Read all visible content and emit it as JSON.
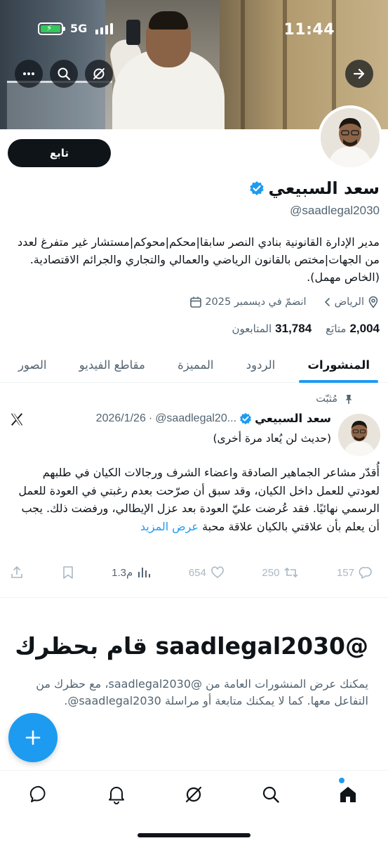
{
  "status_bar": {
    "time": "11:44",
    "network": "5G"
  },
  "profile": {
    "display_name": "سعد السبيعي",
    "handle": "@saadlegal2030",
    "follow_label": "تابع",
    "bio": "مدير الإدارة القانونية بنادي النصر سابقا|محكم|محوكم|مستشار غير متفرغ لعدد من الجهات|مختص بالقانون الرياضي والعمالي والتجاري والجرائم الاقتصادية. (الخاص مهمل).",
    "location": "الرياض",
    "joined": "انضمّ في ديسمبر 2025",
    "following_count": "2,004",
    "following_label": "متابَع",
    "followers_count": "31,784",
    "followers_label": "المتابعون"
  },
  "tabs": [
    {
      "label": "المنشورات"
    },
    {
      "label": "الردود"
    },
    {
      "label": "المميزة"
    },
    {
      "label": "مقاطع الفيديو"
    },
    {
      "label": "الصور"
    }
  ],
  "pinned_post": {
    "pinned_label": "مُثبّت",
    "author_name": "سعد السبيعي",
    "author_handle": "@saadlegal20...",
    "date": "2026/1/26",
    "subtitle": "(حديث لن يُعاد مرة أخرى)",
    "text": "أُقدّر مشاعر الجماهير الصادقة واعضاء الشرف ورجالات الكيان في طلبهم لعودتي للعمل داخل الكيان، وقد سبق أن صرّحت بعدم رغبتي في العودة للعمل الرسمي نهائيًا. فقد عُرضت عليّ العودة بعد عزل الإيطالي، ورفضت ذلك. يجب أن يعلم بأن علاقتي بالكيان علاقة محبة",
    "show_more": "عرض المزيد",
    "replies": "157",
    "reposts": "250",
    "likes": "654",
    "views": "1.3م"
  },
  "blocked": {
    "title": "@saadlegal2030 قام بحظرك",
    "text": "يمكنك عرض المنشورات العامة من @saadlegal2030، مع حظرك من التفاعل معها. كما لا يمكنك متابعة أو مراسلة saadlegal2030@."
  },
  "icons": {
    "top_actions": [
      "more-icon",
      "search-icon",
      "grok-icon",
      "forward-arrow-icon"
    ],
    "bottom_nav": [
      "messages-icon",
      "notifications-icon",
      "grok-icon",
      "search-icon",
      "home-icon"
    ]
  },
  "colors": {
    "accent": "#1d9bf0",
    "text": "#0f1419",
    "muted": "#536471",
    "verified": "#1d9bf0"
  }
}
